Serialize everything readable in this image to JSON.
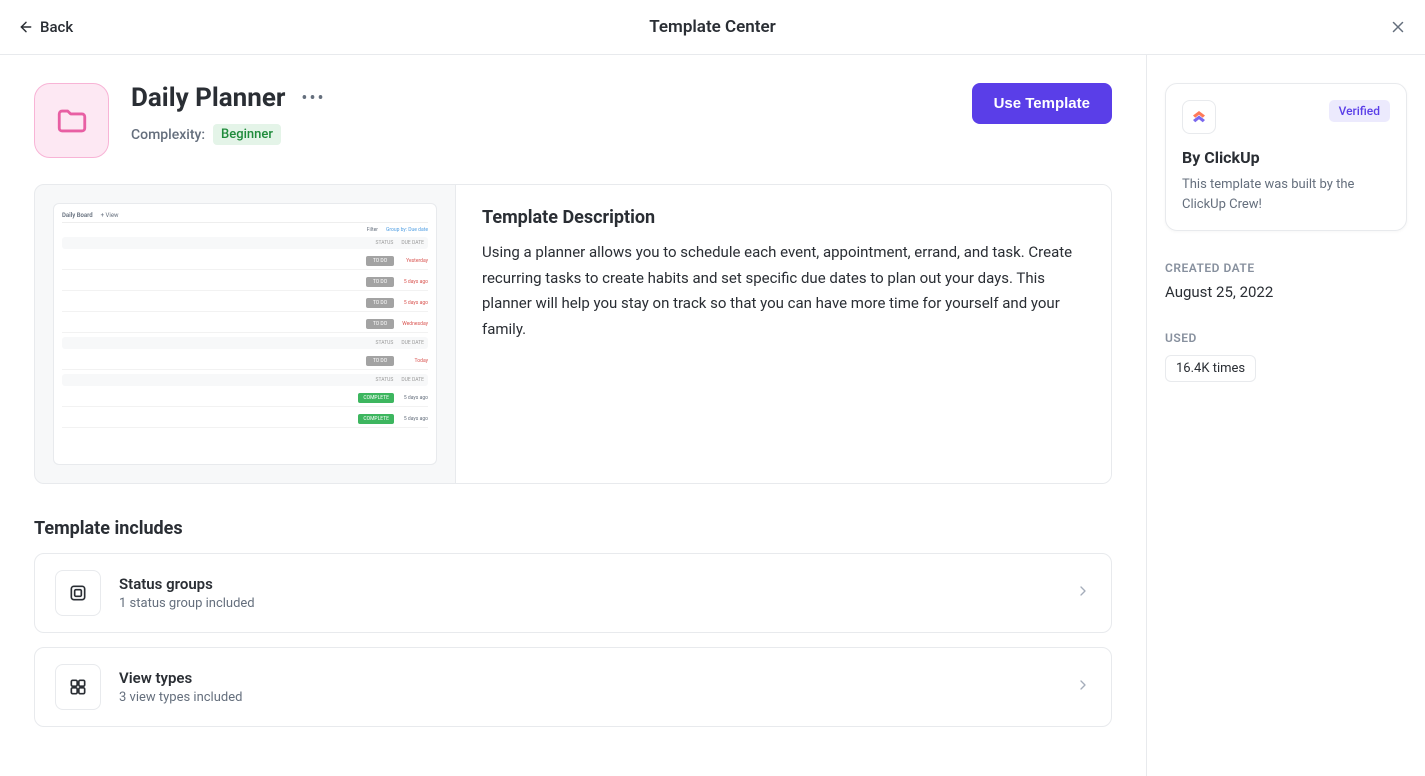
{
  "header": {
    "back_label": "Back",
    "page_title": "Template Center"
  },
  "template": {
    "title": "Daily Planner",
    "complexity_label": "Complexity:",
    "complexity_value": "Beginner",
    "use_button_label": "Use Template",
    "description_heading": "Template Description",
    "description_body": "Using a planner allows you to schedule each event, appointment, errand, and task. Create recurring tasks to create habits and set specific due dates to plan out your days. This planner will help you stay on track so that you can have more time for yourself and your family."
  },
  "preview": {
    "tab_daily": "Daily Board",
    "tab_view": "+ View",
    "filter_label": "Filter",
    "group_label": "Group by: Due date",
    "col_status": "STATUS",
    "col_due": "DUE DATE",
    "rows_a": [
      {
        "status": "TO DO",
        "date": "Yesterday",
        "red": true
      },
      {
        "status": "TO DO",
        "date": "5 days ago",
        "red": true
      },
      {
        "status": "TO DO",
        "date": "5 days ago",
        "red": true
      },
      {
        "status": "TO DO",
        "date": "Wednesday",
        "red": true
      }
    ],
    "rows_b": [
      {
        "status": "TO DO",
        "date": "Today",
        "red": true
      }
    ],
    "rows_c": [
      {
        "status": "COMPLETE",
        "date": "5 days ago",
        "green": true
      },
      {
        "status": "COMPLETE",
        "date": "5 days ago",
        "green": true
      }
    ]
  },
  "includes": {
    "section_title": "Template includes",
    "items": [
      {
        "name": "Status groups",
        "sub": "1 status group included"
      },
      {
        "name": "View types",
        "sub": "3 view types included"
      }
    ]
  },
  "sidebar": {
    "verified_label": "Verified",
    "by_label": "By ClickUp",
    "by_desc": "This template was built by the ClickUp Crew!",
    "created_label": "Created Date",
    "created_value": "August 25, 2022",
    "used_label": "Used",
    "used_value": "16.4K times"
  }
}
